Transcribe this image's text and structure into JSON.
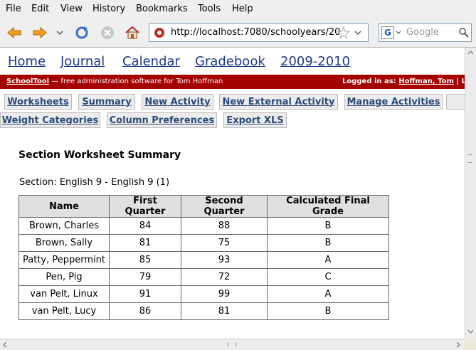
{
  "menu": [
    "File",
    "Edit",
    "View",
    "History",
    "Bookmarks",
    "Tools",
    "Help"
  ],
  "address": {
    "url": "http://localhost:7080/schoolyears/20"
  },
  "search": {
    "placeholder": "Google"
  },
  "nav": [
    "Home",
    "Journal",
    "Calendar",
    "Gradebook",
    "2009-2010"
  ],
  "banner": {
    "brand": "SchoolTool",
    "tagline": " — free administration software for Tom Hoffman",
    "logged_in_label": "Logged in as: ",
    "user": "Hoffman, Tom",
    "sep": " | L"
  },
  "tabs_row1": [
    "Worksheets",
    "Summary",
    "New Activity",
    "New External Activity",
    "Manage Activities"
  ],
  "tabs_row2": [
    "Weight Categories",
    "Column Preferences",
    "Export XLS"
  ],
  "page": {
    "title": "Section Worksheet Summary",
    "section_label": "Section:",
    "section_value": "English 9 - English 9 (1)"
  },
  "table": {
    "headers": [
      "Name",
      "First Quarter",
      "Second Quarter",
      "Calculated Final Grade"
    ],
    "rows": [
      [
        "Brown, Charles",
        "84",
        "88",
        "B"
      ],
      [
        "Brown, Sally",
        "81",
        "75",
        "B"
      ],
      [
        "Patty, Peppermint",
        "85",
        "93",
        "A"
      ],
      [
        "Pen, Pig",
        "79",
        "72",
        "C"
      ],
      [
        "van Pelt, Linux",
        "91",
        "99",
        "A"
      ],
      [
        "van Pelt, Lucy",
        "86",
        "81",
        "B"
      ]
    ]
  },
  "colors": {
    "link": "#1f3a8c",
    "banner": "#a50000",
    "header_bg": "#e0e0e0"
  }
}
